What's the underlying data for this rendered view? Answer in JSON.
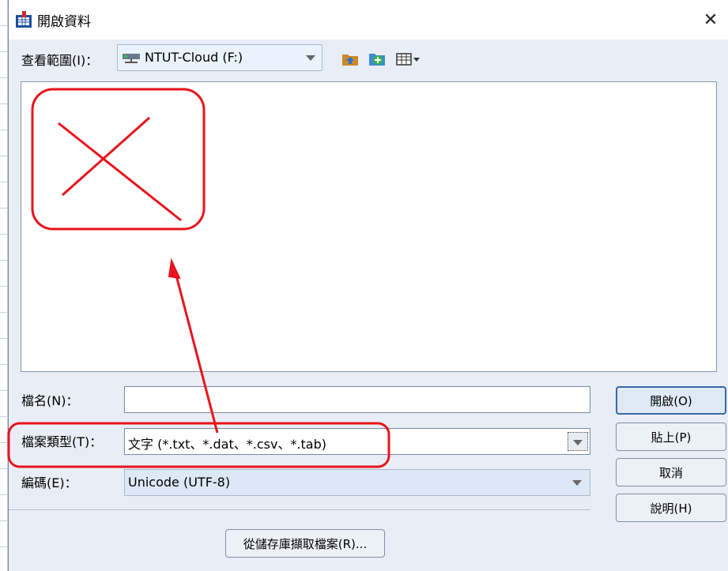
{
  "window": {
    "title": "開啟資料",
    "close_glyph": "✕"
  },
  "lookin": {
    "label": "查看範圍(I)：",
    "value": "NTUT-Cloud (F:)"
  },
  "toolbar": {
    "icons": [
      "up-folder-icon",
      "new-folder-icon",
      "view-menu-icon"
    ]
  },
  "form": {
    "filename_label": "檔名(N)：",
    "filename_value": "",
    "filetype_label": "檔案類型(T)：",
    "filetype_value": "文字 (*.txt、*.dat、*.csv、*.tab)",
    "encoding_label": "編碼(E)：",
    "encoding_value": "Unicode (UTF-8)"
  },
  "buttons": {
    "open": "開啟(O)",
    "paste": "貼上(P)",
    "cancel": "取消",
    "help": "說明(H)",
    "repository": "從儲存庫擷取檔案(R)..."
  },
  "colors": {
    "dialog_bg": "#e9eef6",
    "annotation": "#e8141b"
  }
}
